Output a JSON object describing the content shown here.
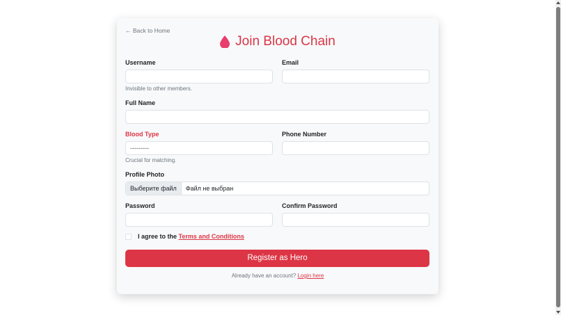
{
  "nav": {
    "back_label": "← Back to Home"
  },
  "header": {
    "title": "Join Blood Chain",
    "icon": "blood-drop-icon",
    "accent": "#dc3545"
  },
  "form": {
    "username_label": "Username",
    "username_help": "Invisible to other members.",
    "email_label": "Email",
    "full_name_label": "Full Name",
    "blood_type_label": "Blood Type",
    "blood_type_value": "---------",
    "blood_type_help": "Crucial for matching.",
    "phone_label": "Phone Number",
    "photo_label": "Profile Photo",
    "photo_button": "Выберите файл",
    "photo_status": "Файл не выбран",
    "password_label": "Password",
    "confirm_password_label": "Confirm Password",
    "agree_prefix": "I agree to the ",
    "terms_link": "Terms and Conditions",
    "submit_label": "Register as Hero",
    "login_prompt": "Already have an account? ",
    "login_link": "Login here"
  }
}
